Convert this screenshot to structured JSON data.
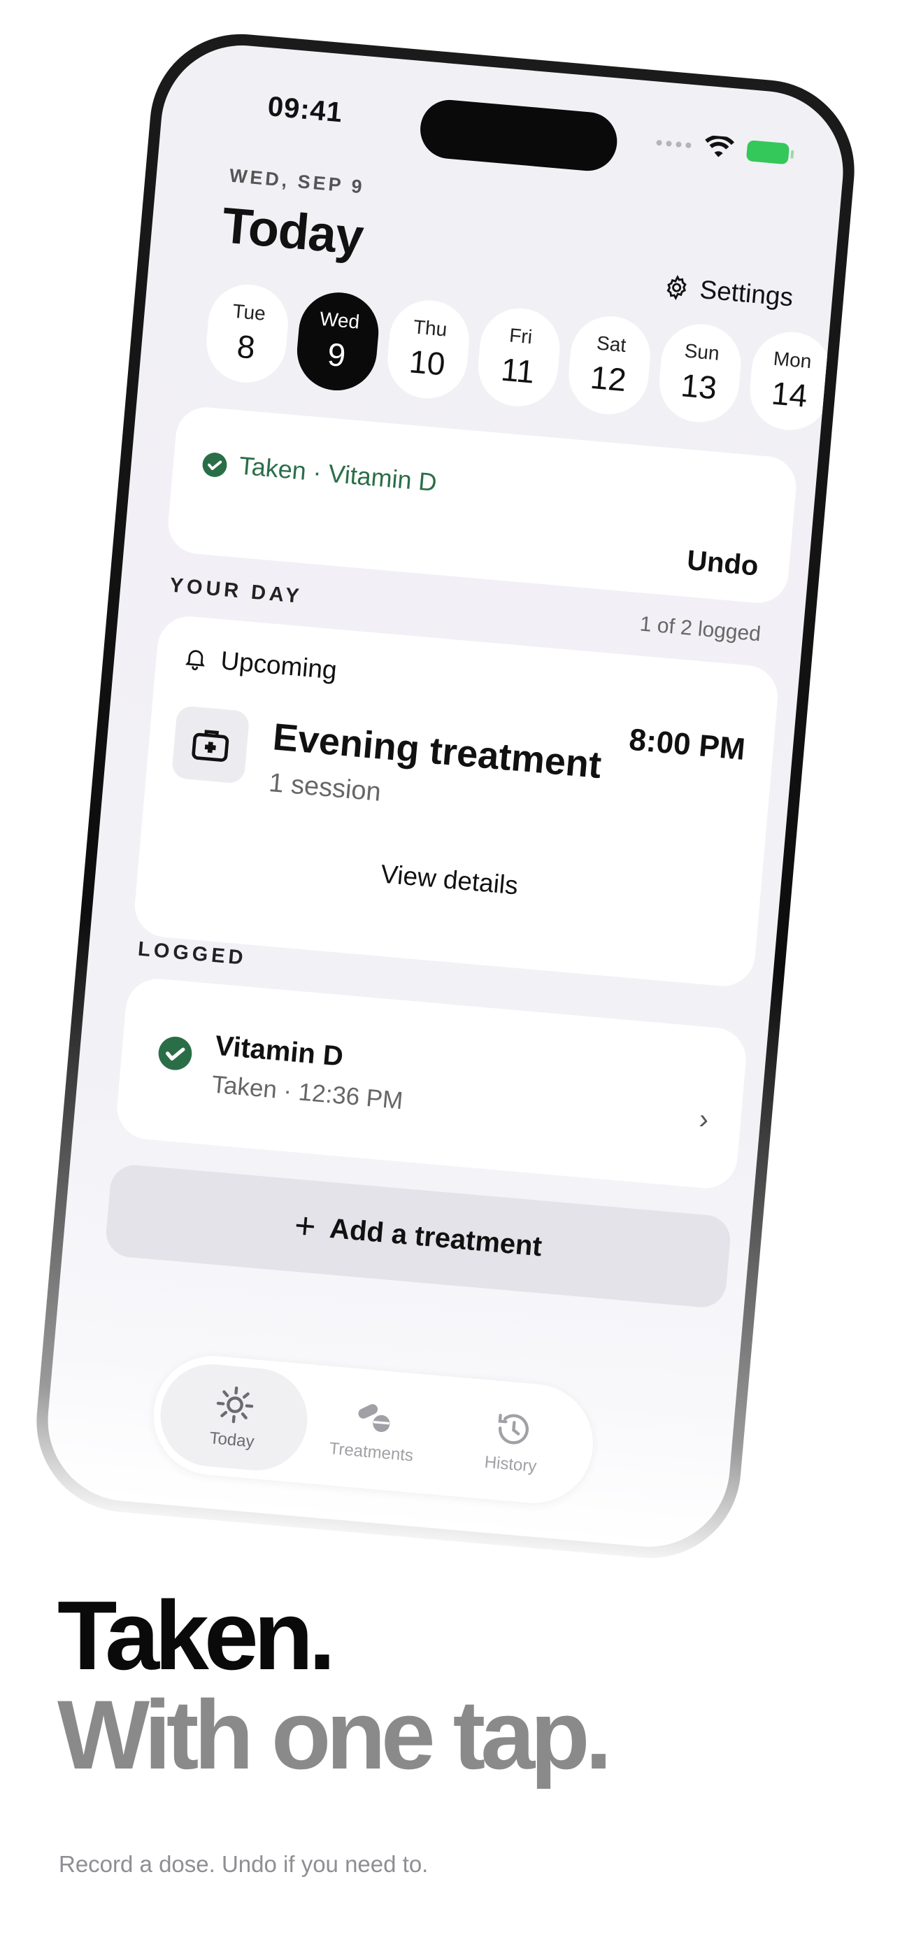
{
  "status": {
    "time": "09:41"
  },
  "header": {
    "date_caps": "WED, SEP 9",
    "title": "Today",
    "settings_label": "Settings"
  },
  "days": [
    {
      "name": "Tue",
      "date": "8",
      "selected": false
    },
    {
      "name": "Wed",
      "date": "9",
      "selected": true
    },
    {
      "name": "Thu",
      "date": "10",
      "selected": false
    },
    {
      "name": "Fri",
      "date": "11",
      "selected": false
    },
    {
      "name": "Sat",
      "date": "12",
      "selected": false
    },
    {
      "name": "Sun",
      "date": "13",
      "selected": false
    },
    {
      "name": "Mon",
      "date": "14",
      "selected": false
    }
  ],
  "toast": {
    "message": "Taken · Vitamin D",
    "action": "Undo"
  },
  "your_day": {
    "caption": "YOUR DAY",
    "count": "1 of 2 logged",
    "upcoming_label": "Upcoming",
    "time": "8:00 PM",
    "treatment_name": "Evening treatment",
    "sessions": "1 session",
    "view_details": "View details"
  },
  "logged": {
    "caption": "LOGGED",
    "items": [
      {
        "name": "Vitamin D",
        "detail": "Taken · 12:36 PM"
      }
    ]
  },
  "add_button": {
    "label": "Add a treatment"
  },
  "tabs": [
    {
      "label": "Today",
      "icon": "sun-icon",
      "active": true
    },
    {
      "label": "Treatments",
      "icon": "pills-icon",
      "active": false
    },
    {
      "label": "History",
      "icon": "history-icon",
      "active": false
    }
  ],
  "colors": {
    "accent_green": "#2a6e48",
    "selected_day": "#0a0a0a",
    "battery": "#34c759"
  },
  "marketing": {
    "headline_line1": "Taken.",
    "headline_line2": "With one tap.",
    "subline": "Record a dose. Undo if you need to."
  }
}
